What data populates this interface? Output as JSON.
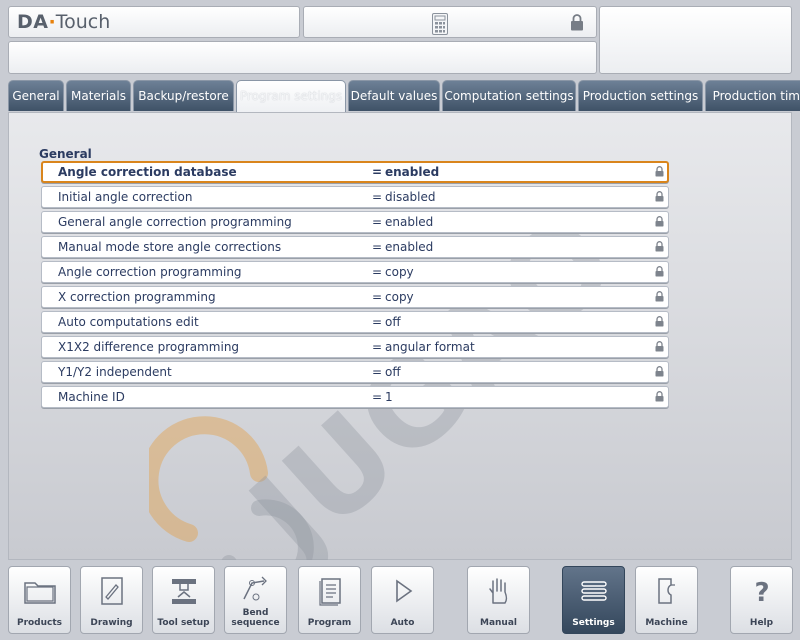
{
  "header": {
    "logo_da": "DA",
    "logo_dot": "·",
    "logo_touch": "Touch",
    "calculator_icon": "calculator-icon",
    "lock_icon": "lock-icon"
  },
  "tabs": [
    {
      "label": "General"
    },
    {
      "label": "Materials"
    },
    {
      "label": "Backup/restore"
    },
    {
      "label": "Program settings",
      "active": true
    },
    {
      "label": "Default values"
    },
    {
      "label": "Computation settings"
    },
    {
      "label": "Production settings"
    },
    {
      "label": "Production time"
    }
  ],
  "watermark_text": "JUGAO",
  "section": {
    "title": "General",
    "rows": [
      {
        "name": "Angle correction database",
        "eq": "=",
        "value": "enabled",
        "selected": true
      },
      {
        "name": "Initial angle correction",
        "eq": "=",
        "value": "disabled"
      },
      {
        "name": "General angle correction programming",
        "eq": "=",
        "value": "enabled"
      },
      {
        "name": "Manual mode store angle corrections",
        "eq": "=",
        "value": "enabled"
      },
      {
        "name": "Angle correction programming",
        "eq": "=",
        "value": "copy"
      },
      {
        "name": "X correction programming",
        "eq": "=",
        "value": "copy"
      },
      {
        "name": "Auto computations edit",
        "eq": "=",
        "value": "off"
      },
      {
        "name": "X1X2 difference programming",
        "eq": "=",
        "value": "angular format"
      },
      {
        "name": "Y1/Y2 independent",
        "eq": "=",
        "value": "off"
      },
      {
        "name": "Machine ID",
        "eq": "=",
        "value": "1"
      }
    ]
  },
  "toolbar": {
    "buttons": [
      {
        "label": "Products",
        "icon": "folder-icon"
      },
      {
        "label": "Drawing",
        "icon": "drawing-icon"
      },
      {
        "label": "Tool setup",
        "icon": "tool-setup-icon"
      },
      {
        "label_line1": "Bend",
        "label_line2": "sequence",
        "icon": "bend-sequence-icon"
      },
      {
        "label": "Program",
        "icon": "program-icon"
      },
      {
        "label": "Auto",
        "icon": "play-icon"
      },
      {
        "label": "Manual",
        "icon": "hand-icon"
      },
      {
        "label": "Settings",
        "icon": "settings-list-icon",
        "active": true
      },
      {
        "label": "Machine",
        "icon": "machine-icon"
      },
      {
        "label": "Help",
        "icon": "question-icon"
      }
    ]
  },
  "colors": {
    "accent_orange": "#e7810c",
    "tab_blue": "#4a5d73",
    "text_navy": "#2b3b61",
    "active_button": "#4a5d73"
  }
}
